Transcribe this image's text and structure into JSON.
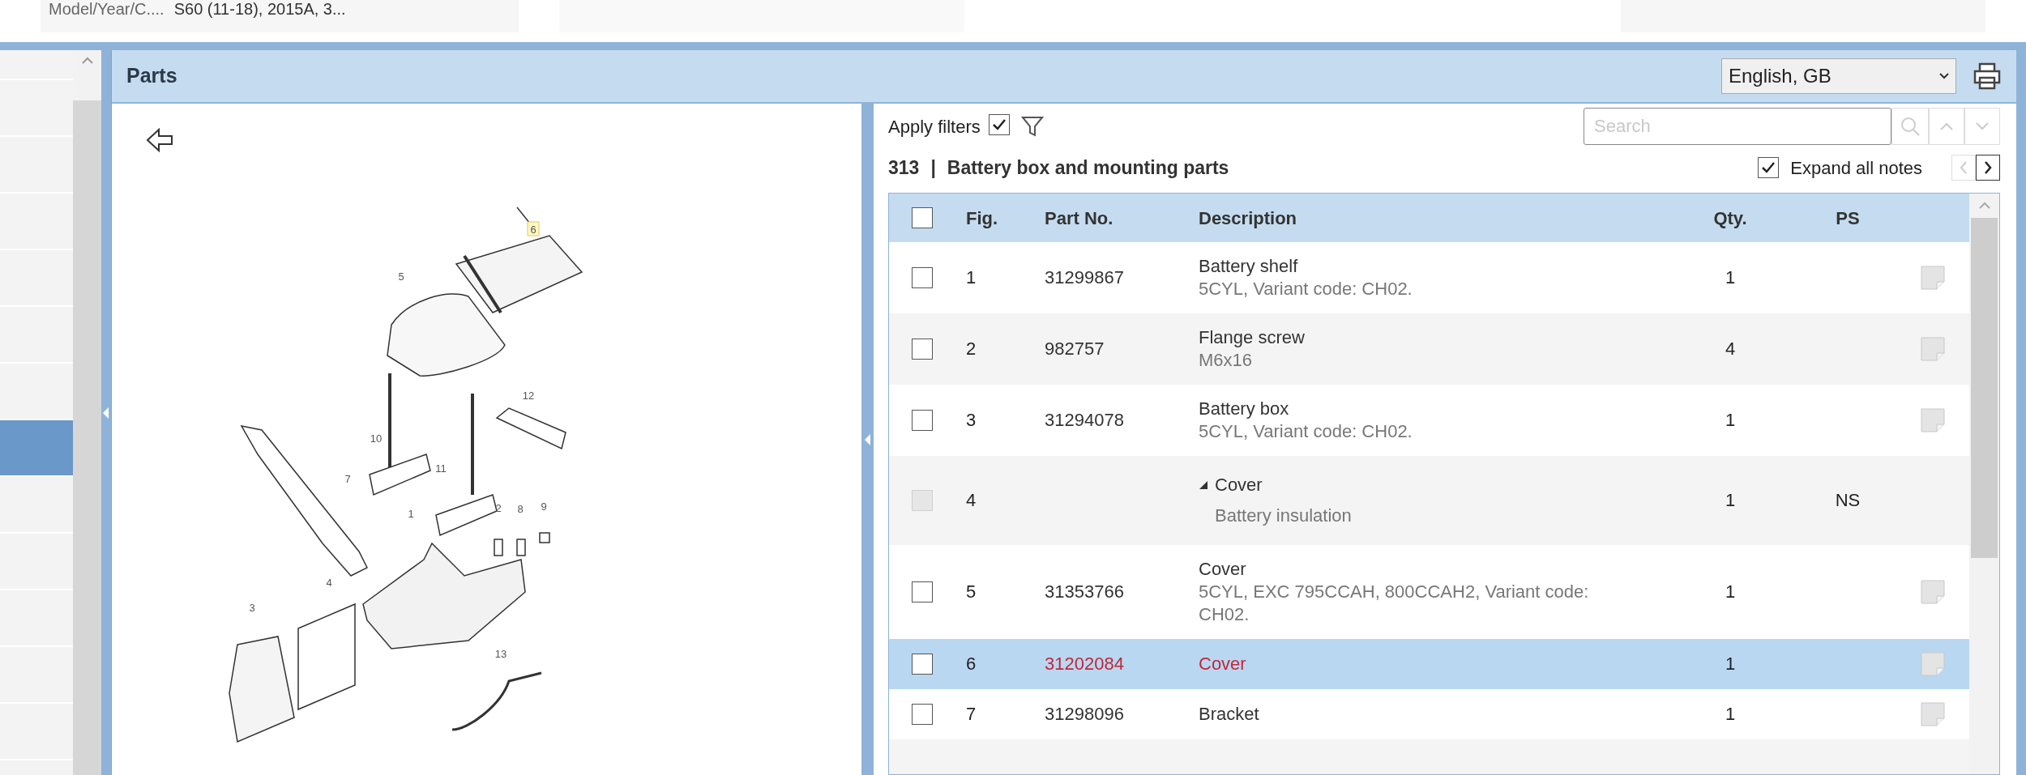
{
  "top_bar": {
    "model_label": "Model/Year/C....",
    "model_value": "S60 (11-18), 2015A, 3..."
  },
  "sidebar": {
    "items": [
      {
        "selected": false
      },
      {
        "selected": false
      },
      {
        "selected": false
      },
      {
        "selected": false
      },
      {
        "selected": false
      },
      {
        "selected": false
      },
      {
        "selected": false
      },
      {
        "selected": true
      },
      {
        "selected": false
      },
      {
        "selected": false
      },
      {
        "selected": false
      },
      {
        "selected": false
      },
      {
        "selected": false
      },
      {
        "selected": false
      }
    ]
  },
  "parts_panel": {
    "title": "Parts",
    "language": "English, GB"
  },
  "diagram": {
    "callouts": [
      {
        "label": "6",
        "selected": true
      },
      {
        "label": "5",
        "selected": false
      },
      {
        "label": "12",
        "selected": false
      },
      {
        "label": "10",
        "selected": false
      },
      {
        "label": "7",
        "selected": false
      },
      {
        "label": "11",
        "selected": false
      },
      {
        "label": "1",
        "selected": false
      },
      {
        "label": "2",
        "selected": false
      },
      {
        "label": "8",
        "selected": false
      },
      {
        "label": "9",
        "selected": false
      },
      {
        "label": "4",
        "selected": false
      },
      {
        "label": "3",
        "selected": false
      },
      {
        "label": "13",
        "selected": false
      }
    ]
  },
  "toolbar": {
    "apply_filters_label": "Apply filters",
    "apply_filters_checked": true,
    "search_placeholder": "Search",
    "expand_notes_label": "Expand all notes",
    "expand_notes_checked": true
  },
  "group": {
    "number": "313",
    "separator": "|",
    "title": "Battery box and mounting parts"
  },
  "table": {
    "columns": [
      "Fig.",
      "Part No.",
      "Description",
      "Qty.",
      "PS"
    ],
    "select_all_checked": false,
    "rows": [
      {
        "kind": "part",
        "fig": "1",
        "part_no": "31299867",
        "description": "Battery shelf",
        "note": "5CYL, Variant code: CH02.",
        "qty": "1",
        "checked": false,
        "selected": false
      },
      {
        "kind": "part",
        "fig": "2",
        "part_no": "982757",
        "description": "Flange screw",
        "note": "M6x16",
        "qty": "4",
        "checked": false,
        "selected": false
      },
      {
        "kind": "part",
        "fig": "3",
        "part_no": "31294078",
        "description": "Battery box",
        "note": "5CYL, Variant code: CH02.",
        "qty": "1",
        "checked": false,
        "selected": false
      },
      {
        "kind": "group",
        "fig": "4",
        "description": "Cover",
        "note": "Battery insulation",
        "qty": "1",
        "ps": "NS",
        "expanded": true,
        "checked": false,
        "selected": false
      },
      {
        "kind": "part",
        "fig": "5",
        "part_no": "31353766",
        "description": "Cover",
        "note": "5CYL, EXC 795CCAH, 800CCAH2, Variant code: CH02.",
        "qty": "1",
        "checked": false,
        "selected": false
      },
      {
        "kind": "part",
        "fig": "6",
        "part_no": "31202084",
        "description": "Cover",
        "qty": "1",
        "checked": false,
        "selected": true
      },
      {
        "kind": "part",
        "fig": "7",
        "part_no": "31298096",
        "description": "Bracket",
        "qty": "1",
        "checked": false,
        "selected": false
      }
    ]
  }
}
